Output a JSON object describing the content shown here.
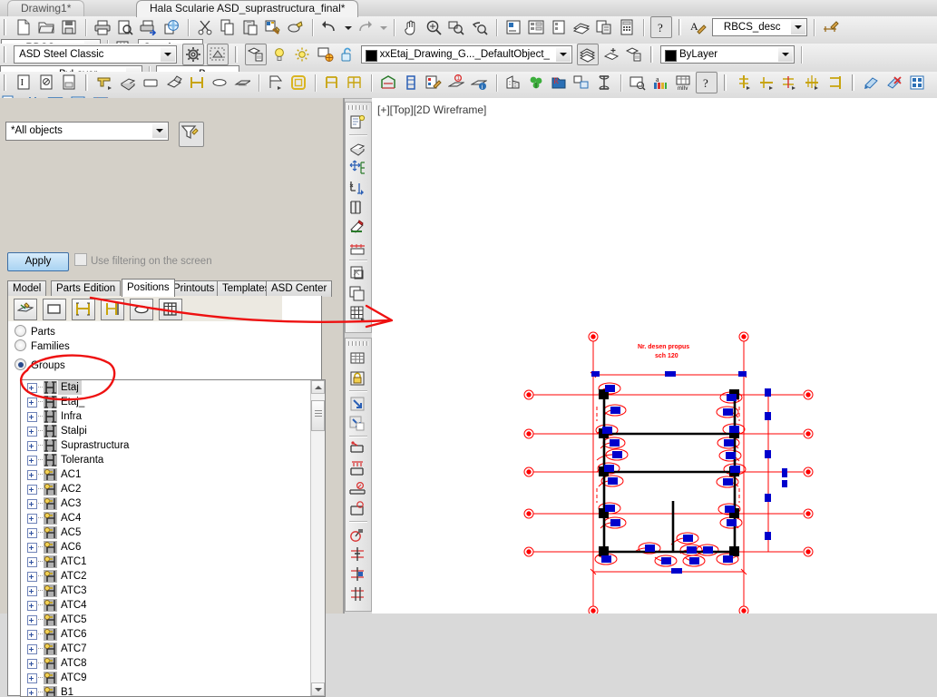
{
  "window": {
    "tabs": [
      {
        "label": "Drawing1*",
        "active": false
      },
      {
        "label": "Hala Scularie ASD_suprastructura_final*",
        "active": true
      }
    ],
    "close_glyph": "✕"
  },
  "toolbar_row1": {
    "icons": [
      "new-file-icon",
      "open-folder-icon",
      "save-icon",
      "print-icon",
      "print-preview-icon",
      "plot-icon",
      "publish-icon",
      "cut-icon",
      "copy-icon",
      "paste-icon",
      "match-properties-icon",
      "paste-block-icon",
      "undo-icon",
      "undo-dropdown-icon",
      "redo-icon",
      "redo-dropdown-icon",
      "pan-icon",
      "zoom-realtime-icon",
      "zoom-window-icon",
      "zoom-previous-icon",
      "properties-icon",
      "designcenter-icon",
      "tool-palettes-icon",
      "sheet-set-icon",
      "markup-icon",
      "calculator-icon",
      "help-icon"
    ],
    "text_style_icon": "text-style-icon",
    "text_style": "RBCS_desc",
    "dim_style_icon": "dimension-style-icon",
    "dim_style": "RBCS_",
    "table_style_icon": "table-style-icon",
    "table_style": "Standard"
  },
  "toolbar_row2": {
    "workspace": "ASD Steel Classic",
    "workspace_settings_icon": "gear-icon",
    "workspace_display_icon": "workspace-display-icon",
    "layer_props_icon": "layer-properties-icon",
    "layer_on_icon": "lightbulb-icon",
    "layer_freeze_icon": "sun-icon",
    "layer_freeze_vp_icon": "freeze-viewport-icon",
    "layer_lock_icon": "unlock-icon",
    "layer_name": "xxEtaj_Drawing_G..._DefaultObject_",
    "layer_color": "#000000",
    "layer_prev_icon": "layer-previous-icon",
    "layer_make_current_icon": "make-object-layer-current-icon",
    "layer_states_icon": "layer-states-icon",
    "color_value": "ByLayer",
    "color_swatch": "#000000",
    "linetype_value": "ByLayer",
    "lineweight_value": "ByLa"
  },
  "toolbar_row3": {
    "icons": [
      "text-icon",
      "block-attribute-icon",
      "field-icon",
      "beam-icon",
      "plate-icon",
      "rect-plate-icon",
      "folded-plate-icon",
      "bolt-icon",
      "weld-icon",
      "shear-stud-icon",
      "connection-vault-icon",
      "grid-icon",
      "frame-icon",
      "frames-group-icon",
      "portal-frame-icon",
      "tower-icon",
      "properties-steel-icon",
      "numbering-icon",
      "checking-icon",
      "building-icon",
      "clean-icon",
      "camera-icon",
      "drawing-style-icon",
      "explorer-icon",
      "drawing-process-icon",
      "bom-icon",
      "list-icon",
      "help2-icon",
      "anchor-detail-icon",
      "base-plate-icon",
      "splice-icon",
      "stiffener-icon",
      "end-plate-icon",
      "create-drawing-icon",
      "delete-drawing-icon",
      "detail-icon",
      "multi-detail-icon",
      "grid-detail-icon",
      "filter-icon",
      "view-icon",
      "delete-view-icon"
    ]
  },
  "left_panel": {
    "filter_value": "*All objects",
    "filter_icon": "filter-funnel-icon",
    "apply_label": "Apply",
    "use_filter_label": "Use filtering on the screen",
    "use_filter_checked": false,
    "tabs": [
      {
        "label": "Model",
        "selected": false
      },
      {
        "label": "Parts Edition",
        "selected": false
      },
      {
        "label": "Positions",
        "selected": true
      },
      {
        "label": "Printouts",
        "selected": false
      },
      {
        "label": "Templates",
        "selected": false
      },
      {
        "label": "ASD Center",
        "selected": false
      }
    ],
    "tool_icons": [
      "numbering-tool-icon",
      "plate-tool-icon",
      "beam-pair-icon",
      "beam-single-icon",
      "folded-plate-tool-icon",
      "grid-tool-icon"
    ],
    "radio_options": [
      {
        "label": "Parts",
        "selected": false
      },
      {
        "label": "Families",
        "selected": false
      },
      {
        "label": "Groups",
        "selected": true
      }
    ],
    "tree_items": [
      {
        "label": "Etaj",
        "icon": "group-frame-icon",
        "selected": true
      },
      {
        "label": "Etaj_",
        "icon": "group-frame-icon",
        "selected": false
      },
      {
        "label": "Infra",
        "icon": "group-frame-icon",
        "selected": false
      },
      {
        "label": "Stalpi",
        "icon": "group-frame-icon",
        "selected": false
      },
      {
        "label": "Suprastructura",
        "icon": "group-frame-icon",
        "selected": false
      },
      {
        "label": "Toleranta",
        "icon": "group-frame-icon",
        "selected": false
      },
      {
        "label": "AC1",
        "icon": "group-bolt-icon",
        "selected": false
      },
      {
        "label": "AC2",
        "icon": "group-bolt-icon",
        "selected": false
      },
      {
        "label": "AC3",
        "icon": "group-bolt-icon",
        "selected": false
      },
      {
        "label": "AC4",
        "icon": "group-bolt-icon",
        "selected": false
      },
      {
        "label": "AC5",
        "icon": "group-bolt-icon",
        "selected": false
      },
      {
        "label": "AC6",
        "icon": "group-bolt-icon",
        "selected": false
      },
      {
        "label": "ATC1",
        "icon": "group-bolt-icon",
        "selected": false
      },
      {
        "label": "ATC2",
        "icon": "group-bolt-icon",
        "selected": false
      },
      {
        "label": "ATC3",
        "icon": "group-bolt-icon",
        "selected": false
      },
      {
        "label": "ATC4",
        "icon": "group-bolt-icon",
        "selected": false
      },
      {
        "label": "ATC5",
        "icon": "group-bolt-icon",
        "selected": false
      },
      {
        "label": "ATC6",
        "icon": "group-bolt-icon",
        "selected": false
      },
      {
        "label": "ATC7",
        "icon": "group-bolt-icon",
        "selected": false
      },
      {
        "label": "ATC8",
        "icon": "group-bolt-icon",
        "selected": false
      },
      {
        "label": "ATC9",
        "icon": "group-bolt-icon",
        "selected": false
      },
      {
        "label": "B1",
        "icon": "group-bolt-icon",
        "selected": false
      }
    ],
    "scrollbar": {
      "up_icon": "scroll-up-icon",
      "down_icon": "scroll-down-icon"
    }
  },
  "vertical_toolbar_left": {
    "icons": [
      "part-properties-icon",
      "plate-create-icon",
      "move-copy-icon",
      "scale-icon",
      "beam-cut-icon",
      "weld-prep-icon",
      "dimension-line-icon",
      "copy-view-icon",
      "copy-view2-icon",
      "grid-object-icon"
    ]
  },
  "vertical_toolbar_left2": {
    "icons": [
      "table-icon",
      "lock-icon",
      "insert-arrow-icon",
      "insert-arrow2-icon",
      "beam-detail-icon",
      "beam-dim-icon",
      "beam-anchor-icon",
      "beam-anchor2-icon",
      "bolt-pattern-icon",
      "beam-split-icon",
      "beam-split2-icon",
      "beam-join-icon"
    ]
  },
  "canvas": {
    "viewport_label": "[+][Top][2D Wireframe]",
    "annotation_text_line1": "Nr. desen propus",
    "annotation_text_line2": "sch 120",
    "colors": {
      "geometry": "#FF0000",
      "steel": "#0000CC",
      "structure": "#000000",
      "annotation_markup": "#EE1111"
    }
  },
  "markup": {
    "ellipse_label": "groups-circled-highlight",
    "arrow_label": "pointer-arrow-to-drawing"
  }
}
